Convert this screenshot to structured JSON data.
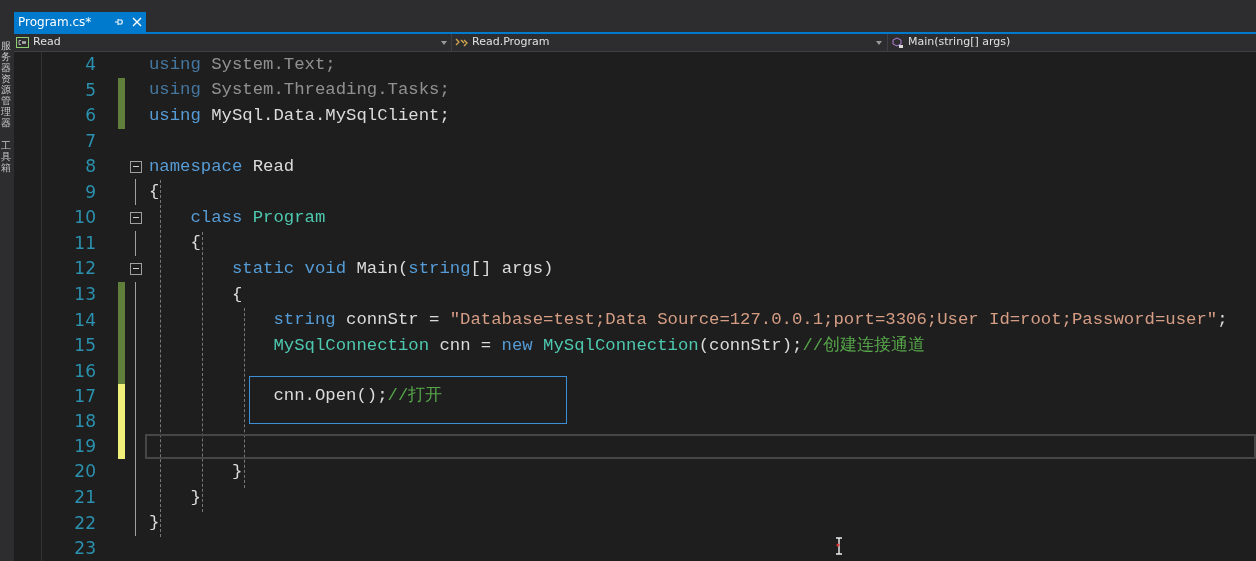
{
  "side_panel": {
    "tabs": [
      "服务器资源管理器",
      "工具箱"
    ]
  },
  "document_tab": {
    "title": "Program.cs*",
    "selected": true
  },
  "navigation_bar": {
    "project": "Read",
    "type": "Read.Program",
    "member": "Main(string[] args)"
  },
  "editor": {
    "lines": [
      {
        "number": "4",
        "dimmed": true,
        "tokens": [
          {
            "kind": "keyword",
            "text": "using"
          },
          {
            "kind": "plain",
            "text": " System.Text;"
          }
        ]
      },
      {
        "number": "5",
        "color": "#5f7f3a",
        "dimmed": true,
        "tokens": [
          {
            "kind": "keyword",
            "text": "using"
          },
          {
            "kind": "plain",
            "text": " System.Threading.Tasks;"
          }
        ]
      },
      {
        "number": "6",
        "color": "#5f7f3a",
        "tokens": [
          {
            "kind": "keyword",
            "text": "using"
          },
          {
            "kind": "plain",
            "text": " MySql.Data.MySqlClient;"
          }
        ]
      },
      {
        "number": "7"
      },
      {
        "number": "8",
        "fold": true,
        "tokens": [
          {
            "kind": "keyword",
            "text": "namespace"
          },
          {
            "kind": "plain",
            "text": " Read"
          }
        ]
      },
      {
        "number": "9",
        "tokens": [
          {
            "kind": "plain",
            "text": "{"
          }
        ]
      },
      {
        "number": "10",
        "fold": true,
        "tokens": [
          {
            "kind": "keyword",
            "text": "    class"
          },
          {
            "kind": "type",
            "text": " Program"
          }
        ]
      },
      {
        "number": "11",
        "tokens": [
          {
            "kind": "plain",
            "text": "    {"
          }
        ]
      },
      {
        "number": "12",
        "fold": true,
        "tokens": [
          {
            "kind": "keyword",
            "text": "        static"
          },
          {
            "kind": "keyword",
            "text": " void"
          },
          {
            "kind": "plain",
            "text": " Main("
          },
          {
            "kind": "keyword",
            "text": "string"
          },
          {
            "kind": "plain",
            "text": "[] args)"
          }
        ]
      },
      {
        "number": "13",
        "color": "#5f7f3a",
        "tokens": [
          {
            "kind": "plain",
            "text": "        {"
          }
        ]
      },
      {
        "number": "14",
        "color": "#5f7f3a",
        "tokens": [
          {
            "kind": "keyword",
            "text": "            string"
          },
          {
            "kind": "plain",
            "text": " connStr = "
          },
          {
            "kind": "string",
            "text": "\"Database=test;Data Source=127.0.0.1;port=3306;User Id=root;Password=user\""
          },
          {
            "kind": "plain",
            "text": ";"
          }
        ]
      },
      {
        "number": "15",
        "color": "#5f7f3a",
        "tokens": [
          {
            "kind": "type",
            "text": "            MySqlConnection"
          },
          {
            "kind": "plain",
            "text": " cnn = "
          },
          {
            "kind": "keyword",
            "text": "new"
          },
          {
            "kind": "type",
            "text": " MySqlConnection"
          },
          {
            "kind": "plain",
            "text": "(connStr);"
          },
          {
            "kind": "comment",
            "text": "//创建连接通道"
          }
        ]
      },
      {
        "number": "16",
        "color": "#5f7f3a"
      },
      {
        "number": "17",
        "color": "#efef7a",
        "boxed": true,
        "tokens": [
          {
            "kind": "plain",
            "text": "            cnn.Open();"
          },
          {
            "kind": "comment",
            "text": "//打开"
          }
        ]
      },
      {
        "number": "18",
        "color": "#efef7a"
      },
      {
        "number": "19",
        "color": "#efef7a",
        "current": true
      },
      {
        "number": "20",
        "tokens": [
          {
            "kind": "plain",
            "text": "        }"
          }
        ]
      },
      {
        "number": "21",
        "tokens": [
          {
            "kind": "plain",
            "text": "    }"
          }
        ]
      },
      {
        "number": "22",
        "tokens": [
          {
            "kind": "plain",
            "text": "}"
          }
        ]
      },
      {
        "number": "23"
      }
    ]
  }
}
